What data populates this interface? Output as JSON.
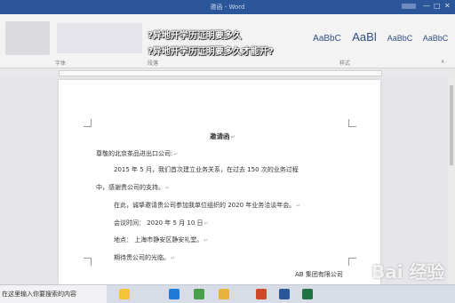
{
  "window": {
    "title": "邀函 - Word"
  },
  "window_buttons": {
    "minimize": "—",
    "maximize": "□",
    "close": "✕"
  },
  "overlay": {
    "line1": "?异地开学历证明要多久",
    "line2": "?异地开学历证明要多久才能开?"
  },
  "ribbon": {
    "styles": [
      "AaBbC",
      "AaBl",
      "AaBbC",
      "AaBbC"
    ],
    "groups": {
      "font": "字体",
      "paragraph": "段落",
      "styles": "样式"
    }
  },
  "document": {
    "title": "邀请函",
    "greeting": "尊敬的北京茶品进出口公司:",
    "para1_line1": "2015 年 5 月，我们首次建立业务关系，在过去 150 次的业务过程",
    "para1_line2": "中，感谢贵公司的支持。",
    "para2": "在此，诚挚邀请贵公司参加我单位组织的 2020 年业务洽谈年会。",
    "meeting_time": "会议时间： 2020 年 5 月 10 日",
    "location": "地点： 上海市静安区静安礼堂。",
    "closing": "期待贵公司的光临。",
    "signature": "AB 集团有限公司",
    "paragraph_mark": "↵"
  },
  "watermark": "Bai 经验",
  "taskbar": {
    "search_placeholder": "在这里输入你要搜索的内容",
    "apps": [
      "file-explorer-icon",
      "edge-icon",
      "chrome-icon",
      "folder-icon",
      "powerpoint-icon",
      "word-icon",
      "excel-icon"
    ],
    "app_colors": [
      "#f3c43a",
      "#1f7ad6",
      "#4aa04a",
      "#e7b33c",
      "#d24726",
      "#2b579a",
      "#217346"
    ]
  }
}
